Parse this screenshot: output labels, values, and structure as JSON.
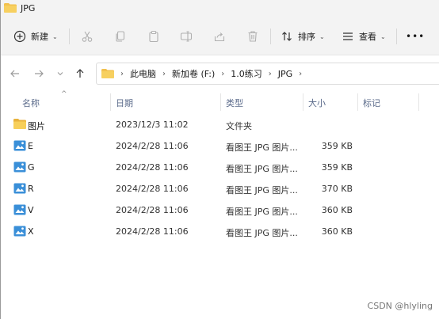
{
  "window": {
    "title": "JPG"
  },
  "toolbar": {
    "new_label": "新建",
    "sort_label": "排序",
    "view_label": "查看",
    "more_label": "•••"
  },
  "nav": {
    "breadcrumbs": [
      "此电脑",
      "新加卷 (F:)",
      "1.0练习",
      "JPG"
    ]
  },
  "columns": {
    "name": "名称",
    "date": "日期",
    "type": "类型",
    "size": "大小",
    "tags": "标记"
  },
  "files": [
    {
      "name": "图片",
      "date": "2023/12/3 11:02",
      "type": "文件夹",
      "size": "",
      "icon": "folder-icon"
    },
    {
      "name": "E",
      "date": "2024/2/28 11:06",
      "type": "看图王 JPG 图片...",
      "size": "359 KB",
      "icon": "jpg-file-icon"
    },
    {
      "name": "G",
      "date": "2024/2/28 11:06",
      "type": "看图王 JPG 图片...",
      "size": "359 KB",
      "icon": "jpg-file-icon"
    },
    {
      "name": "R",
      "date": "2024/2/28 11:06",
      "type": "看图王 JPG 图片...",
      "size": "370 KB",
      "icon": "jpg-file-icon"
    },
    {
      "name": "V",
      "date": "2024/2/28 11:06",
      "type": "看图王 JPG 图片...",
      "size": "360 KB",
      "icon": "jpg-file-icon"
    },
    {
      "name": "X",
      "date": "2024/2/28 11:06",
      "type": "看图王 JPG 图片...",
      "size": "360 KB",
      "icon": "jpg-file-icon"
    }
  ],
  "watermark": "CSDN @hlyling",
  "colors": {
    "folder": "#f2c14e",
    "accent": "#2a6fdb",
    "header_text": "#5a6a8a"
  }
}
